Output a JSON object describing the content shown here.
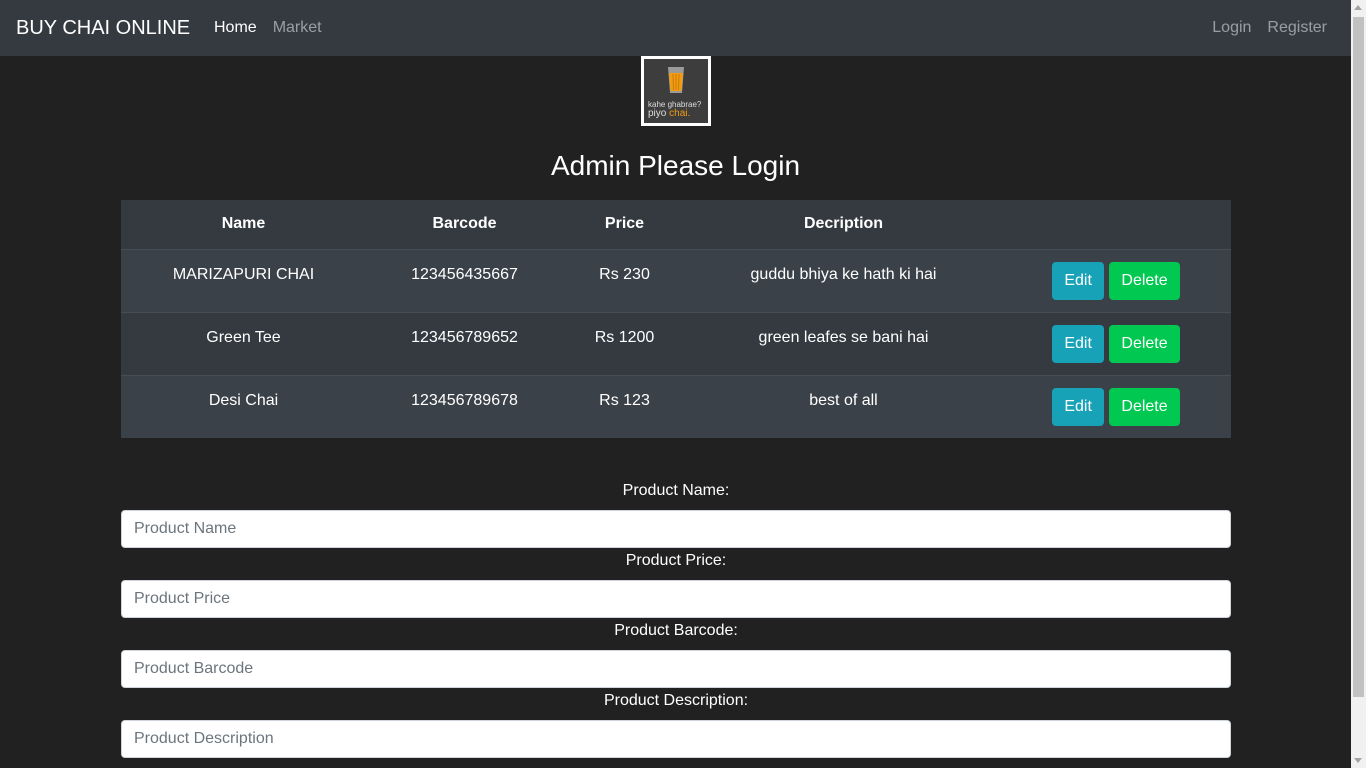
{
  "navbar": {
    "brand": "BUY CHAI ONLINE",
    "left_links": [
      "Home",
      "Market"
    ],
    "right_links": [
      "Login",
      "Register"
    ]
  },
  "logo": {
    "line1": "kahe ghabrae?",
    "line2_a": "piyo",
    "line2_b": "chai.",
    "accent_color": "#f39c12"
  },
  "title": "Admin Please Login",
  "table": {
    "headers": [
      "Name",
      "Barcode",
      "Price",
      "Decription",
      ""
    ],
    "rows": [
      {
        "name": "MARIZAPURI CHAI",
        "barcode": "123456435667",
        "price": "Rs 230",
        "description": "guddu bhiya ke hath ki hai"
      },
      {
        "name": "Green Tee",
        "barcode": "123456789652",
        "price": "Rs 1200",
        "description": "green leafes se bani hai"
      },
      {
        "name": "Desi Chai",
        "barcode": "123456789678",
        "price": "Rs 123",
        "description": "best of all"
      }
    ],
    "edit_label": "Edit",
    "delete_label": "Delete"
  },
  "form": {
    "name_label": "Product Name:",
    "name_placeholder": "Product Name",
    "price_label": "Product Price:",
    "price_placeholder": "Product Price",
    "barcode_label": "Product Barcode:",
    "barcode_placeholder": "Product Barcode",
    "description_label": "Product Description:",
    "description_placeholder": "Product Description"
  },
  "colors": {
    "background": "#212121",
    "navbar": "#343a40",
    "edit_button": "#17a2b8",
    "delete_button": "#00c851"
  }
}
